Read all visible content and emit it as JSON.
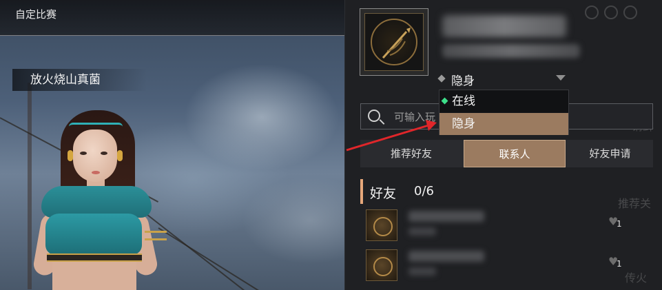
{
  "scene": {
    "title": "自定比赛",
    "player_name": "放火烧山真菌"
  },
  "profile": {
    "status_current": "隐身",
    "status_options": [
      "在线",
      "隐身"
    ]
  },
  "search": {
    "placeholder": "可输入玩"
  },
  "tabs": [
    {
      "label": "推荐好友"
    },
    {
      "label": "联系人"
    },
    {
      "label": "好友申请"
    }
  ],
  "friends_section": {
    "title": "好友",
    "count": "0/6"
  },
  "friends": [
    {
      "likes": "1"
    },
    {
      "likes": "1"
    }
  ],
  "background_hints": [
    "请鲜",
    "推荐关",
    "传火"
  ],
  "colors": {
    "accent": "#9b7b60",
    "section_bar": "#e6a77a",
    "online_dot": "#3de08a",
    "arrow": "#e0262a"
  }
}
